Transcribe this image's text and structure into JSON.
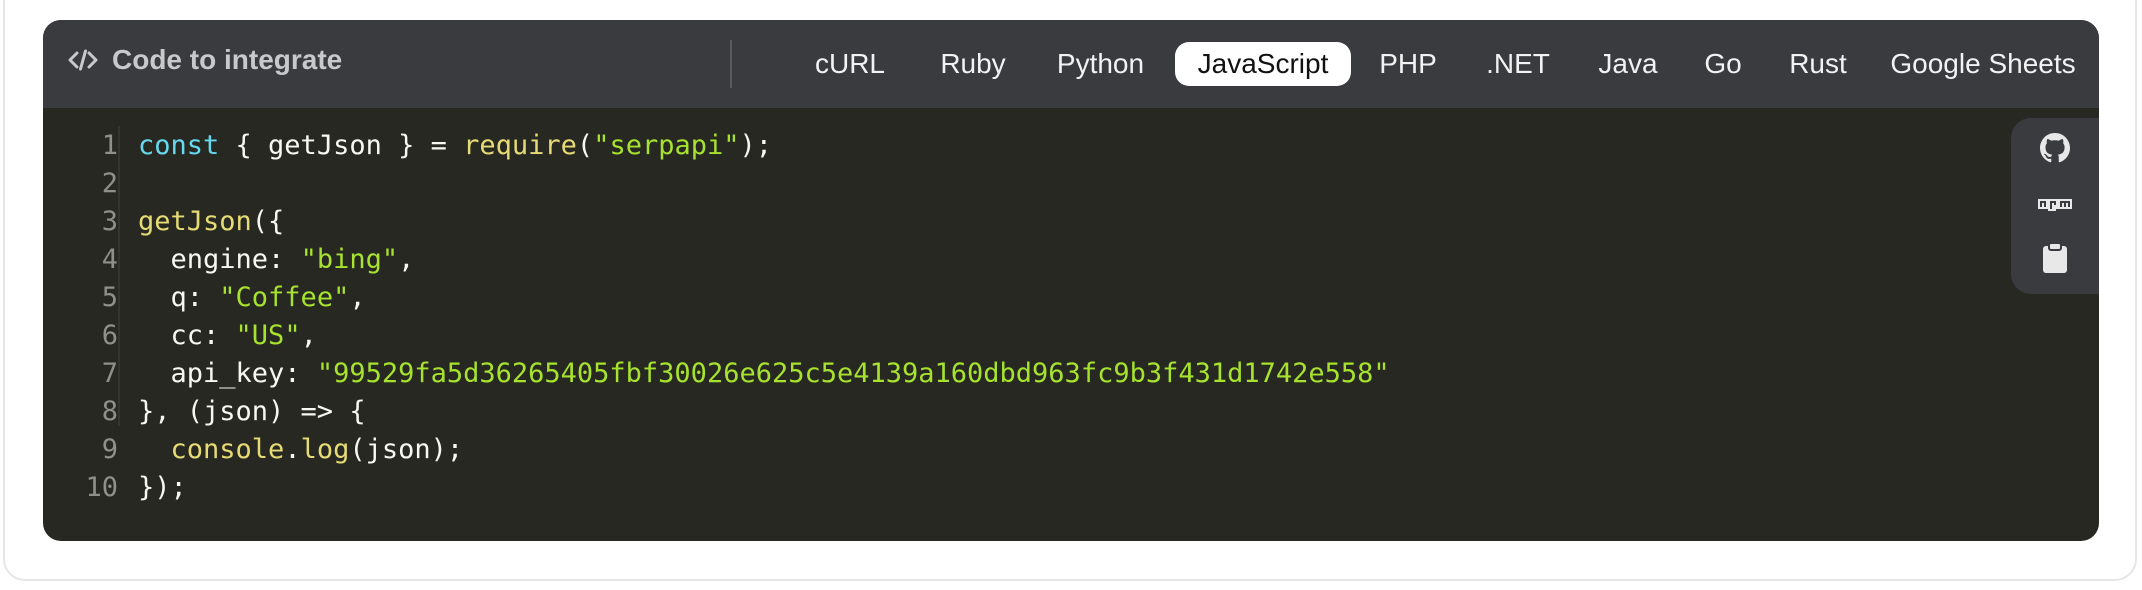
{
  "header": {
    "title": "Code to integrate",
    "icon": "code-icon"
  },
  "tabs": [
    {
      "label": "cURL",
      "active": false
    },
    {
      "label": "Ruby",
      "active": false
    },
    {
      "label": "Python",
      "active": false
    },
    {
      "label": "JavaScript",
      "active": true
    },
    {
      "label": "PHP",
      "active": false
    },
    {
      "label": ".NET",
      "active": false
    },
    {
      "label": "Java",
      "active": false
    },
    {
      "label": "Go",
      "active": false
    },
    {
      "label": "Rust",
      "active": false
    },
    {
      "label": "Google Sheets",
      "active": false
    }
  ],
  "code": {
    "line_numbers": [
      "1",
      "2",
      "3",
      "4",
      "5",
      "6",
      "7",
      "8",
      "9",
      "10"
    ],
    "lines": [
      [
        {
          "t": "kw",
          "v": "const"
        },
        {
          "t": "plain",
          "v": " { getJson } = "
        },
        {
          "t": "fn",
          "v": "require"
        },
        {
          "t": "plain",
          "v": "("
        },
        {
          "t": "str",
          "v": "\"serpapi\""
        },
        {
          "t": "plain",
          "v": ");"
        }
      ],
      [],
      [
        {
          "t": "fn",
          "v": "getJson"
        },
        {
          "t": "plain",
          "v": "({"
        }
      ],
      [
        {
          "t": "plain",
          "v": "  engine: "
        },
        {
          "t": "str",
          "v": "\"bing\""
        },
        {
          "t": "plain",
          "v": ","
        }
      ],
      [
        {
          "t": "plain",
          "v": "  q: "
        },
        {
          "t": "str",
          "v": "\"Coffee\""
        },
        {
          "t": "plain",
          "v": ","
        }
      ],
      [
        {
          "t": "plain",
          "v": "  cc: "
        },
        {
          "t": "str",
          "v": "\"US\""
        },
        {
          "t": "plain",
          "v": ","
        }
      ],
      [
        {
          "t": "plain",
          "v": "  api_key: "
        },
        {
          "t": "str",
          "v": "\"99529fa5d36265405fbf30026e625c5e4139a160dbd963fc9b3f431d1742e558\""
        }
      ],
      [
        {
          "t": "plain",
          "v": "}, (json) => {"
        }
      ],
      [
        {
          "t": "plain",
          "v": "  "
        },
        {
          "t": "fn",
          "v": "console"
        },
        {
          "t": "plain",
          "v": "."
        },
        {
          "t": "fn",
          "v": "log"
        },
        {
          "t": "plain",
          "v": "(json);"
        }
      ],
      [
        {
          "t": "plain",
          "v": "});"
        }
      ]
    ]
  },
  "side_tools": [
    {
      "name": "github-icon"
    },
    {
      "name": "npm-icon"
    },
    {
      "name": "clipboard-icon"
    }
  ],
  "colors": {
    "panel_bg": "#272822",
    "header_bg": "#3a3b3f",
    "keyword": "#66d9ef",
    "function": "#e6db74",
    "string": "#a6e22e",
    "text": "#f8f8f2"
  }
}
